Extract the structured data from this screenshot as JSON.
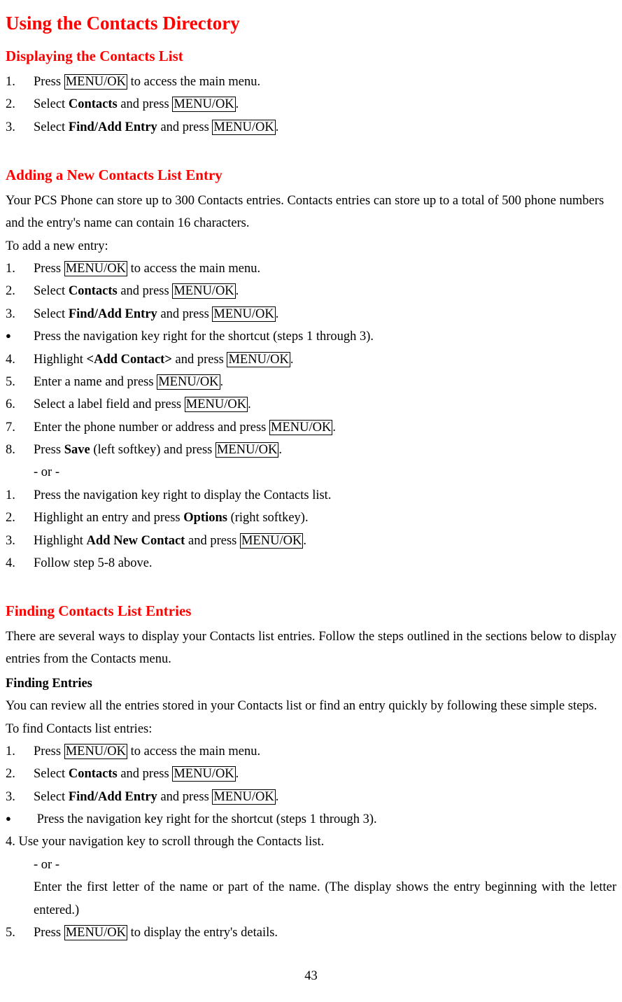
{
  "title": "Using the Contacts Directory",
  "key_label": "MENU/OK",
  "section1": {
    "heading": "Displaying the Contacts List",
    "s1_1a": "Press ",
    "s1_1b": " to access the main menu.",
    "s1_2a": "Select ",
    "s1_2b": "Contacts",
    "s1_2c": " and press ",
    "s1_2d": ".",
    "s1_3a": "Select ",
    "s1_3b": "Find/Add Entry",
    "s1_3c": " and press ",
    "s1_3d": "."
  },
  "section2": {
    "heading": "Adding a New Contacts List Entry",
    "intro": "Your PCS Phone can store up to 300 Contacts entries. Contacts entries can store up to a total of 500 phone numbers and the entry's name can contain 16 characters.",
    "lead": "To add a new entry:",
    "s2_1a": "Press ",
    "s2_1b": " to access the main menu.",
    "s2_2a": "Select ",
    "s2_2b": "Contacts",
    "s2_2c": " and press ",
    "s2_2d": ".",
    "s2_3a": "Select ",
    "s2_3b": "Find/Add Entry",
    "s2_3c": " and press ",
    "s2_3d": ".",
    "s2_bullet": "Press the navigation key right for the shortcut (steps 1 through 3).",
    "s2_4a": "Highlight ",
    "s2_4b": "<Add Contact>",
    "s2_4c": " and press ",
    "s2_4d": ".",
    "s2_5a": "Enter a name and press ",
    "s2_5b": ".",
    "s2_6a": "Select a label field and press ",
    "s2_6b": ".",
    "s2_7a": "Enter the phone number or address and press ",
    "s2_7b": ".",
    "s2_8a": "Press ",
    "s2_8b": "Save",
    "s2_8c": " (left softkey) and press ",
    "s2_8d": ".",
    "or": "- or -",
    "s2b_1": "Press the navigation key right to display the Contacts list.",
    "s2b_2a": "Highlight an entry and press ",
    "s2b_2b": "Options",
    "s2b_2c": " (right softkey).",
    "s2b_3a": "Highlight ",
    "s2b_3b": "Add New Contact",
    "s2b_3c": " and press ",
    "s2b_3d": ".",
    "s2b_4": "Follow step 5-8 above."
  },
  "section3": {
    "heading": "Finding Contacts List Entries",
    "intro": "There are several ways to display your Contacts list entries. Follow the steps outlined in the sections below to display entries from the Contacts menu.",
    "sub": "Finding Entries",
    "sub_intro": "You can review all the entries stored in your Contacts list or find an entry quickly by following these simple steps.",
    "lead": "To find Contacts list entries:",
    "s3_1a": "Press ",
    "s3_1b": " to access the main menu.",
    "s3_2a": "Select ",
    "s3_2b": "Contacts",
    "s3_2c": " and press ",
    "s3_2d": ".",
    "s3_3a": "Select ",
    "s3_3b": "Find/Add Entry",
    "s3_3c": " and press ",
    "s3_3d": ".",
    "s3_bullet": "Press the navigation key right for the shortcut (steps 1 through 3).",
    "s3_4": "4. Use your navigation key to scroll through the Contacts list.",
    "or": "- or -",
    "s3_4b": "Enter the first letter of the name or part of the name. (The display shows the entry beginning with the letter entered.)",
    "s3_5a": "Press ",
    "s3_5b": " to display the entry's details."
  },
  "page": "43"
}
